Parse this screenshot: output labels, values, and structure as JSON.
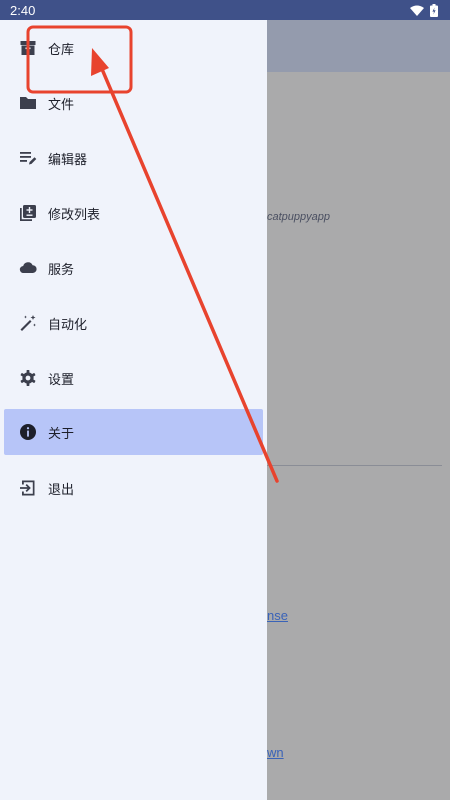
{
  "status_bar": {
    "time": "2:40"
  },
  "drawer": {
    "items": [
      {
        "label": "仓库",
        "icon": "repository-icon",
        "active": false
      },
      {
        "label": "文件",
        "icon": "folder-icon",
        "active": false
      },
      {
        "label": "编辑器",
        "icon": "editor-icon",
        "active": false
      },
      {
        "label": "修改列表",
        "icon": "changelist-icon",
        "active": false
      },
      {
        "label": "服务",
        "icon": "cloud-icon",
        "active": false
      },
      {
        "label": "自动化",
        "icon": "magic-wand-icon",
        "active": false
      },
      {
        "label": "设置",
        "icon": "gear-icon",
        "active": false
      },
      {
        "label": "关于",
        "icon": "info-icon",
        "active": true
      },
      {
        "label": "退出",
        "icon": "exit-icon",
        "active": false
      }
    ]
  },
  "background": {
    "author_fragment": "catpuppyapp",
    "link1_fragment": "nse",
    "link2_fragment": "wn"
  },
  "colors": {
    "status_bar": "#3f5189",
    "drawer_bg": "#f0f3fb",
    "active_item_bg": "#b7c5f8",
    "annotation": "#e8432e",
    "scrim": "#aaaaab"
  }
}
